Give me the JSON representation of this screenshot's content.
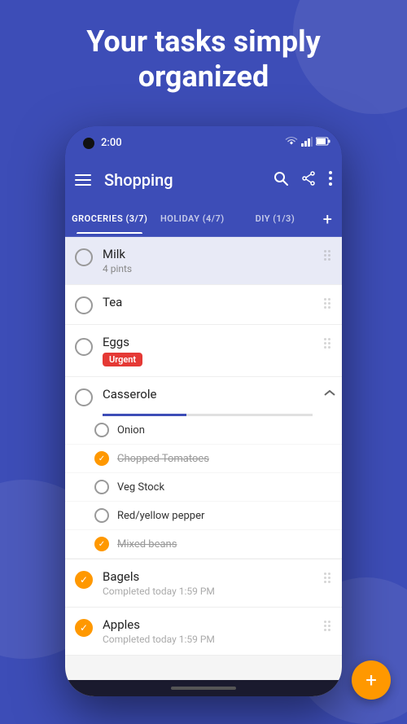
{
  "hero": {
    "title_line1": "Your tasks simply",
    "title_line2": "organized"
  },
  "status_bar": {
    "time": "2:00"
  },
  "app_bar": {
    "title": "Shopping",
    "search_label": "search",
    "share_label": "share",
    "more_label": "more options"
  },
  "tabs": [
    {
      "label": "GROCERIES (3/7)",
      "active": true
    },
    {
      "label": "HOLIDAY (4/7)",
      "active": false
    },
    {
      "label": "DIY (1/3)",
      "active": false
    }
  ],
  "tasks": [
    {
      "id": "milk",
      "title": "Milk",
      "subtitle": "4 pints",
      "completed": false,
      "highlighted": true,
      "urgent": false
    },
    {
      "id": "tea",
      "title": "Tea",
      "subtitle": "",
      "completed": false,
      "highlighted": false,
      "urgent": false
    },
    {
      "id": "eggs",
      "title": "Eggs",
      "subtitle": "",
      "completed": false,
      "highlighted": false,
      "urgent": true,
      "urgent_label": "Urgent"
    },
    {
      "id": "casserole",
      "title": "Casserole",
      "subtitle": "",
      "completed": false,
      "highlighted": false,
      "urgent": false,
      "has_sub_items": true,
      "progress_percent": 40
    }
  ],
  "sub_items": [
    {
      "id": "onion",
      "text": "Onion",
      "completed": false
    },
    {
      "id": "chopped-tomatoes",
      "text": "Chopped Tomatoes",
      "completed": true
    },
    {
      "id": "veg-stock",
      "text": "Veg Stock",
      "completed": false
    },
    {
      "id": "red-yellow-pepper",
      "text": "Red/yellow pepper",
      "completed": false
    },
    {
      "id": "mixed-beans",
      "text": "Mixed beans",
      "completed": true
    }
  ],
  "completed_tasks": [
    {
      "id": "bagels",
      "title": "Bagels",
      "subtitle": "Completed today 1:59 PM",
      "completed": true
    },
    {
      "id": "apples",
      "title": "Apples",
      "subtitle": "Completed today 1:59 PM",
      "completed": true
    }
  ],
  "fab": {
    "label": "+"
  }
}
